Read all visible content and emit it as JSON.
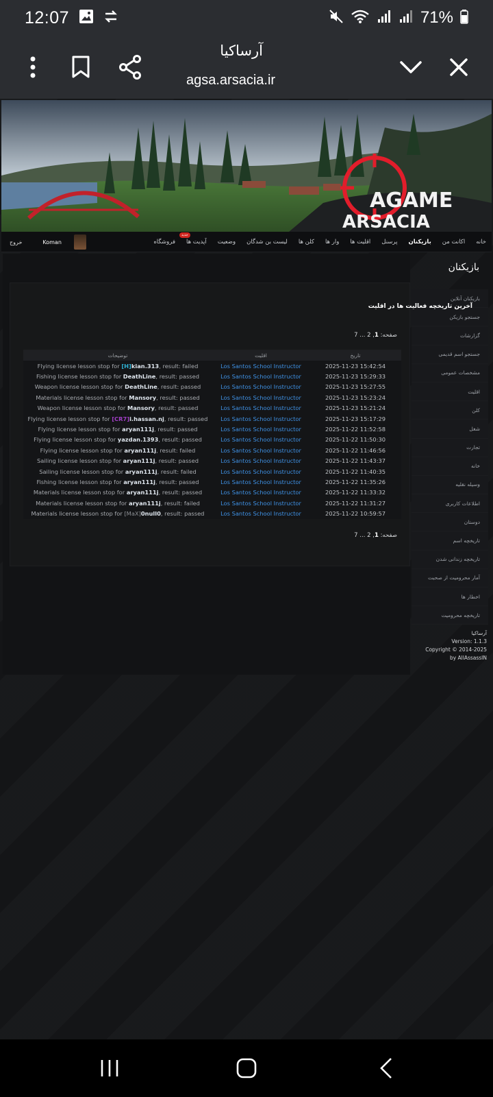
{
  "status": {
    "time": "12:07",
    "battery": "71%"
  },
  "browser": {
    "title": "آرساکیا",
    "url": "agsa.arsacia.ir"
  },
  "banner": {
    "logo_line1": "AGAME",
    "logo_line2": "ARSACIA"
  },
  "nav": {
    "items": [
      "خانه",
      "اکانت من",
      "بازیکنان",
      "پرسنل",
      "اقلیت ها",
      "وار ها",
      "کلن ها",
      "لیست بن شدگان",
      "وضعیت",
      "آپدیت ها",
      "فروشگاه"
    ],
    "active_index": 2,
    "badge": "جدید",
    "username": "Koman",
    "logout": "خروج"
  },
  "section_title": "بازیکنان",
  "sidebar": {
    "items": [
      "بازیکنان آنلاین",
      "جستجو بازیکن",
      "گزارشات",
      "جستجو اسم قدیمی",
      "مشخصات عمومی",
      "اقلیت",
      "کلن",
      "شغل",
      "تجارت",
      "خانه",
      "وسیله نقلیه",
      "اطلاعات کاربری",
      "دوستان",
      "تاریخچه اسم",
      "تاریخچه زندانی شدن",
      "آمار محرومیت از صحبت",
      "اخطار ها",
      "تاریخچه محرومیت"
    ],
    "footer": [
      "آرساکیا",
      "Version: 1.1.3",
      "Copyright © 2014-2025",
      "by AllAssassIN"
    ]
  },
  "content": {
    "title": "آخرین تاریخچه فعالیت ها در اقلیت",
    "pager_label": "صفحه:",
    "pager_current": "1",
    "pager_rest": ", 2 ... 7",
    "headers": {
      "date": "تاریخ",
      "faction": "اقلیت",
      "desc": "توضیحات"
    },
    "rows": [
      {
        "desc_pre": "Flying license lesson stop for ",
        "tag": "[H]",
        "tag_color": "cyan",
        "name": "kian.313",
        "result": ", result: failed",
        "faction": "Los Santos School Instructor",
        "date": "2025-11-23 15:42:54"
      },
      {
        "desc_pre": "Fishing license lesson stop for ",
        "tag": "",
        "tag_color": "",
        "name": "DeathLine",
        "result": ", result: passed",
        "faction": "Los Santos School Instructor",
        "date": "2025-11-23 15:29:33"
      },
      {
        "desc_pre": "Weapon license lesson stop for ",
        "tag": "",
        "tag_color": "",
        "name": "DeathLine",
        "result": ", result: passed",
        "faction": "Los Santos School Instructor",
        "date": "2025-11-23 15:27:55"
      },
      {
        "desc_pre": "Materials license lesson stop for ",
        "tag": "",
        "tag_color": "",
        "name": "Mansory",
        "result": ", result: passed",
        "faction": "Los Santos School Instructor",
        "date": "2025-11-23 15:23:24"
      },
      {
        "desc_pre": "Weapon license lesson stop for ",
        "tag": "",
        "tag_color": "",
        "name": "Mansory",
        "result": ", result: passed",
        "faction": "Los Santos School Instructor",
        "date": "2025-11-23 15:21:24"
      },
      {
        "desc_pre": "Flying license lesson stop for ",
        "tag": "[CR7]",
        "tag_color": "purple",
        "name": "i.hassan.nj",
        "result": ", result: passed",
        "faction": "Los Santos School Instructor",
        "date": "2025-11-23 15:17:29"
      },
      {
        "desc_pre": "Flying license lesson stop for ",
        "tag": "",
        "tag_color": "",
        "name": "aryan111j",
        "result": ", result: passed",
        "faction": "Los Santos School Instructor",
        "date": "2025-11-22 11:52:58"
      },
      {
        "desc_pre": "Flying license lesson stop for ",
        "tag": "",
        "tag_color": "",
        "name": "yazdan.1393",
        "result": ", result: passed",
        "faction": "Los Santos School Instructor",
        "date": "2025-11-22 11:50:30"
      },
      {
        "desc_pre": "Flying license lesson stop for ",
        "tag": "",
        "tag_color": "",
        "name": "aryan111j",
        "result": ", result: failed",
        "faction": "Los Santos School Instructor",
        "date": "2025-11-22 11:46:56"
      },
      {
        "desc_pre": "Sailing license lesson stop for ",
        "tag": "",
        "tag_color": "",
        "name": "aryan111j",
        "result": ", result: passed",
        "faction": "Los Santos School Instructor",
        "date": "2025-11-22 11:43:37"
      },
      {
        "desc_pre": "Sailing license lesson stop for ",
        "tag": "",
        "tag_color": "",
        "name": "aryan111j",
        "result": ", result: failed",
        "faction": "Los Santos School Instructor",
        "date": "2025-11-22 11:40:35"
      },
      {
        "desc_pre": "Fishing license lesson stop for ",
        "tag": "",
        "tag_color": "",
        "name": "aryan111j",
        "result": ", result: passed",
        "faction": "Los Santos School Instructor",
        "date": "2025-11-22 11:35:26"
      },
      {
        "desc_pre": "Materials license lesson stop for ",
        "tag": "",
        "tag_color": "",
        "name": "aryan111j",
        "result": ", result: passed",
        "faction": "Los Santos School Instructor",
        "date": "2025-11-22 11:33:32"
      },
      {
        "desc_pre": "Materials license lesson stop for ",
        "tag": "",
        "tag_color": "",
        "name": "aryan111j",
        "result": ", result: failed",
        "faction": "Los Santos School Instructor",
        "date": "2025-11-22 11:31:27"
      },
      {
        "desc_pre": "Materials license lesson stop for ",
        "tag": "[MaX]",
        "tag_color": "gray",
        "name": "0null0",
        "result": ", result: passed",
        "faction": "Los Santos School Instructor",
        "date": "2025-11-22 10:59:57"
      }
    ]
  }
}
